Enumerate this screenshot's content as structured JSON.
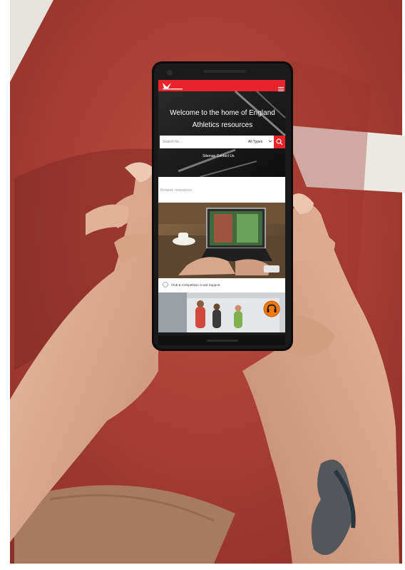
{
  "phone_screen": {
    "hero_title": "Welcome to the home of England Athletics resources",
    "search_placeholder": "Search for...",
    "type_filter": "All Types",
    "links": "Sitemap  Contact Us",
    "section_title": "Browse resources",
    "card_title": "Club & Competition Covid Support"
  },
  "colors": {
    "track": "#b8453a",
    "brand_red": "#e8232a",
    "chat_orange": "#f07a12",
    "screen_dark": "#141414"
  }
}
